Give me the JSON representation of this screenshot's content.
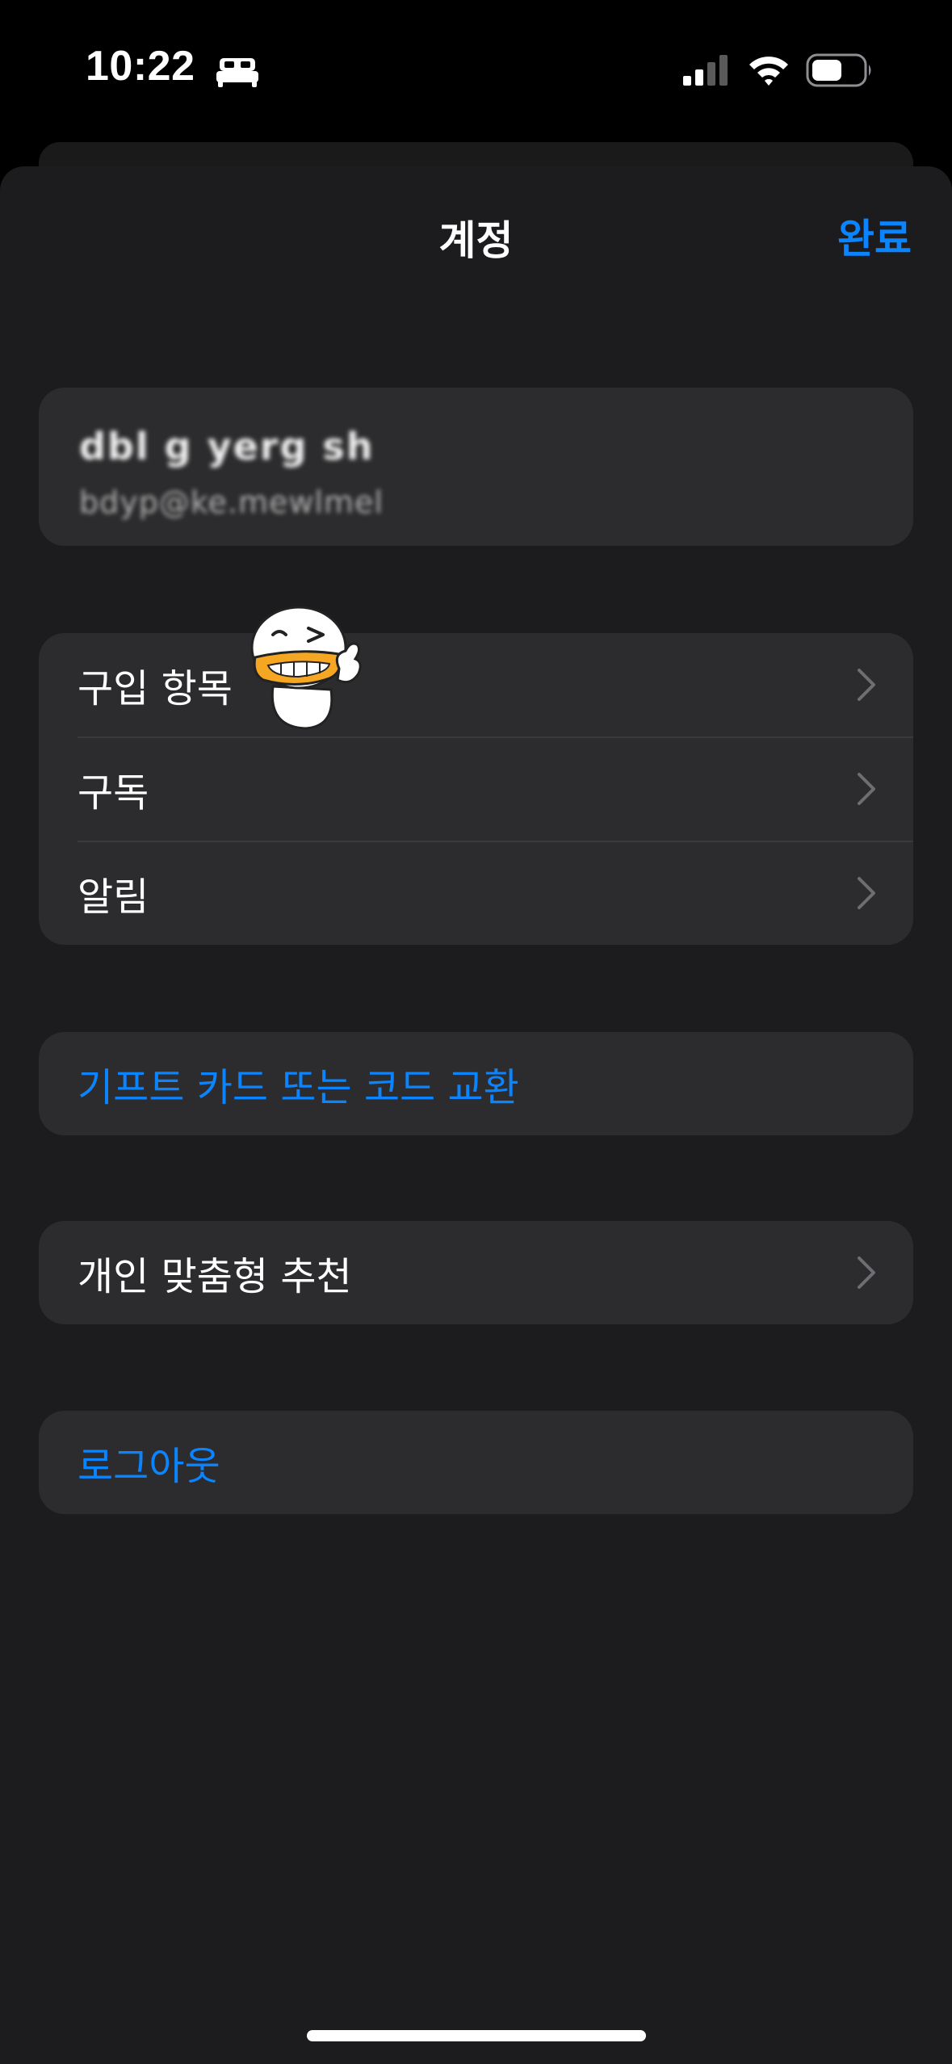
{
  "status_bar": {
    "time": "10:22",
    "icons": [
      "bed-icon",
      "cellular-signal-icon",
      "wifi-icon",
      "battery-icon"
    ]
  },
  "nav": {
    "title": "계정",
    "done_label": "완료"
  },
  "profile": {
    "name": "dbl g yerg sh",
    "email": "bdyp@ke.mewlmel"
  },
  "menu": {
    "items": [
      {
        "label": "구입 항목"
      },
      {
        "label": "구독"
      },
      {
        "label": "알림"
      }
    ]
  },
  "gift_card": {
    "label": "기프트 카드 또는 코드 교환"
  },
  "personal": {
    "label": "개인 맞춤형 추천"
  },
  "logout": {
    "label": "로그아웃"
  },
  "colors": {
    "accent": "#0a84ff",
    "sheet_background": "#1c1c1e",
    "card_background": "#2c2c2e",
    "separator": "#3a3a3c"
  }
}
